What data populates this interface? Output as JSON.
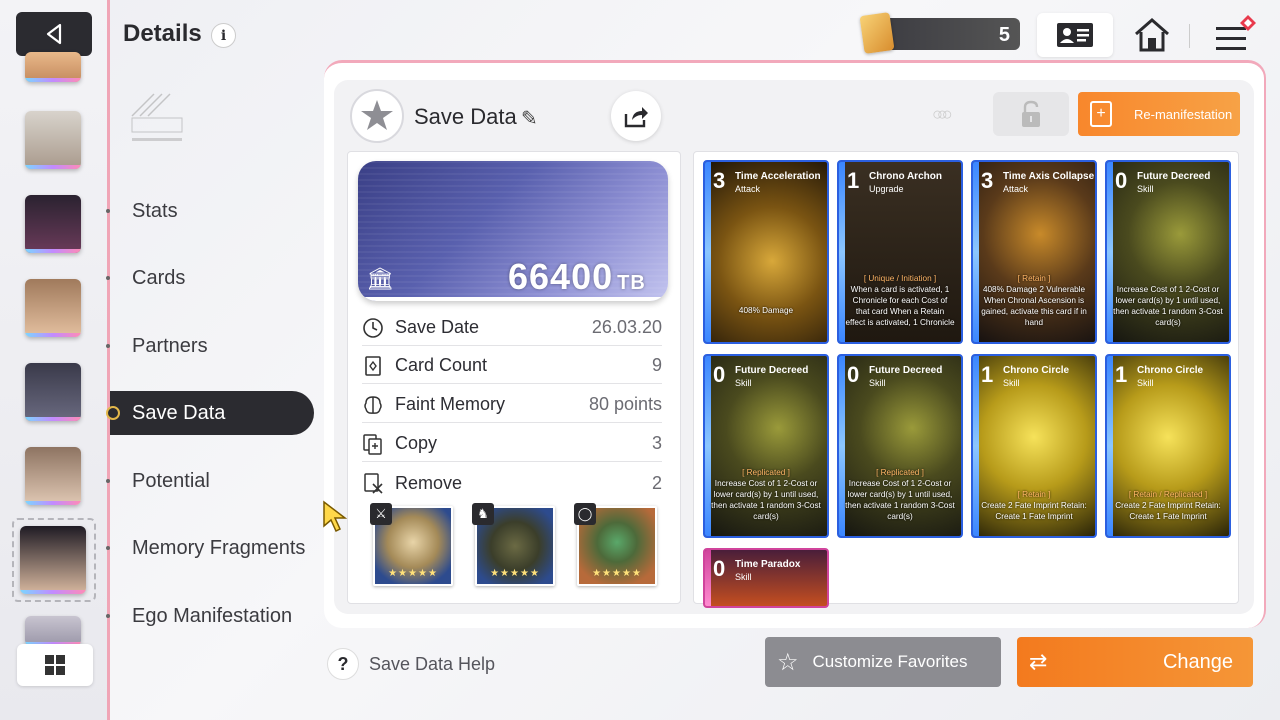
{
  "header": {
    "title": "Details",
    "info_icon": "i"
  },
  "currency": {
    "value": "5"
  },
  "nav": {
    "items": [
      {
        "label": "Stats"
      },
      {
        "label": "Cards"
      },
      {
        "label": "Partners"
      },
      {
        "label": "Save Data"
      },
      {
        "label": "Potential"
      },
      {
        "label": "Memory Fragments"
      },
      {
        "label": "Ego Manifestation"
      }
    ],
    "active": "Save Data"
  },
  "save_data": {
    "title": "Save Data",
    "capacity_value": "66400",
    "capacity_unit": "TB",
    "remanifestation_label": "Re-manifestation",
    "stats": [
      {
        "label": "Save Date",
        "value": "26.03.20",
        "icon": "clock-icon"
      },
      {
        "label": "Card Count",
        "value": "9",
        "icon": "card-icon"
      },
      {
        "label": "Faint Memory",
        "value": "80 points",
        "icon": "brain-icon"
      },
      {
        "label": "Copy",
        "value": "3",
        "icon": "copy-icon"
      },
      {
        "label": "Remove",
        "value": "2",
        "icon": "remove-icon"
      }
    ],
    "equipment": [
      {
        "name": "book",
        "tag_icon": "sword-icon",
        "stars": "★★★★★"
      },
      {
        "name": "armor",
        "tag_icon": "armor-icon",
        "stars": "★★★★★"
      },
      {
        "name": "leaf",
        "tag_icon": "ring-icon",
        "stars": "★★★★★"
      }
    ]
  },
  "cards": [
    {
      "cost": "3",
      "name": "Time Acceleration",
      "type": "Attack",
      "tag": "",
      "desc": "408% Damage"
    },
    {
      "cost": "1",
      "name": "Chrono Archon",
      "type": "Upgrade",
      "tag": "[ Unique / Initiation ]",
      "desc": "When a card is activated, 1 Chronicle for each Cost of that card When a Retain effect is activated, 1 Chronicle"
    },
    {
      "cost": "3",
      "name": "Time Axis Collapse",
      "type": "Attack",
      "tag": "[ Retain ]",
      "desc": "408% Damage 2 Vulnerable When Chronal Ascension is gained, activate this card if in hand"
    },
    {
      "cost": "0",
      "name": "Future Decreed",
      "type": "Skill",
      "tag": "",
      "desc": "Increase Cost of 1 2-Cost or lower card(s) by 1 until used, then activate 1 random 3-Cost card(s)"
    },
    {
      "cost": "0",
      "name": "Future Decreed",
      "type": "Skill",
      "tag": "[ Replicated ]",
      "desc": "Increase Cost of 1 2-Cost or lower card(s) by 1 until used, then activate 1 random 3-Cost card(s)"
    },
    {
      "cost": "0",
      "name": "Future Decreed",
      "type": "Skill",
      "tag": "[ Replicated ]",
      "desc": "Increase Cost of 1 2-Cost or lower card(s) by 1 until used, then activate 1 random 3-Cost card(s)"
    },
    {
      "cost": "1",
      "name": "Chrono Circle",
      "type": "Skill",
      "tag": "[ Retain ]",
      "desc": "Create 2 Fate Imprint Retain: Create 1 Fate Imprint"
    },
    {
      "cost": "1",
      "name": "Chrono Circle",
      "type": "Skill",
      "tag": "[ Retain / Replicated ]",
      "desc": "Create 2 Fate Imprint Retain: Create 1 Fate Imprint"
    },
    {
      "cost": "0",
      "name": "Time Paradox",
      "type": "Skill",
      "tag": "",
      "desc": ""
    }
  ],
  "footer": {
    "help_label": "Save Data Help",
    "help_icon": "?",
    "favorites_label": "Customize Favorites",
    "change_label": "Change"
  }
}
